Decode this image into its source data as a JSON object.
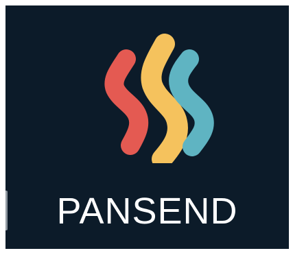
{
  "brand": {
    "name": "PANSEND",
    "icon": "pansend-logo-icon",
    "colors": {
      "background": "#0c1b29",
      "stripe_left": "#e45a52",
      "stripe_middle": "#f5c25d",
      "stripe_right": "#5fb4c2",
      "text": "#ffffff"
    }
  }
}
